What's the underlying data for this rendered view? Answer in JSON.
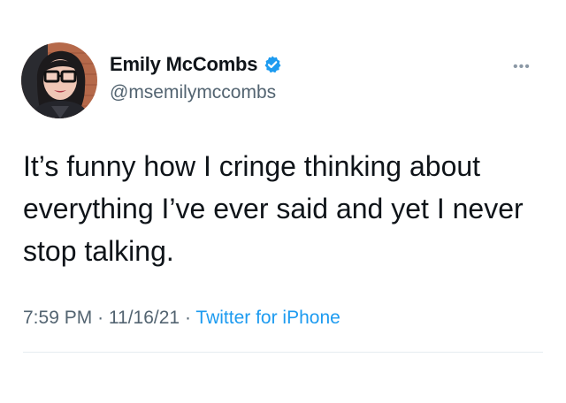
{
  "author": {
    "display_name": "Emily McCombs",
    "handle": "@msemilymccombs",
    "verified": true,
    "verified_icon": "verified-badge-icon",
    "avatar_icon": "profile-photo"
  },
  "tweet": {
    "text": "It’s funny how I cringe thinking about everything I’ve ever said and yet I never stop talking.",
    "time": "7:59 PM",
    "date": "11/16/21",
    "separator": "·",
    "source": "Twitter for iPhone"
  },
  "menu": {
    "more_label": "•••",
    "more_icon": "more-options-icon"
  },
  "colors": {
    "text": "#0f1419",
    "secondary": "#536471",
    "accent": "#1d9bf0",
    "verified": "#1d9bf0"
  }
}
